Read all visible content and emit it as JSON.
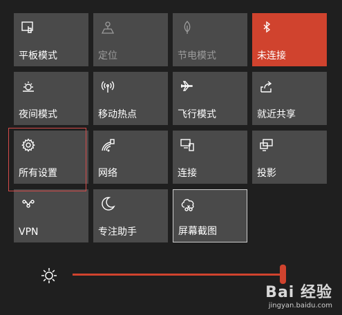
{
  "tiles": [
    {
      "label": "平板模式",
      "icon": "tablet-mode-icon",
      "state": "normal"
    },
    {
      "label": "定位",
      "icon": "location-icon",
      "state": "disabled"
    },
    {
      "label": "节电模式",
      "icon": "battery-saver-icon",
      "state": "disabled"
    },
    {
      "label": "未连接",
      "icon": "bluetooth-icon",
      "state": "active"
    },
    {
      "label": "夜间模式",
      "icon": "night-light-icon",
      "state": "normal"
    },
    {
      "label": "移动热点",
      "icon": "mobile-hotspot-icon",
      "state": "normal"
    },
    {
      "label": "飞行模式",
      "icon": "airplane-icon",
      "state": "normal"
    },
    {
      "label": "就近共享",
      "icon": "nearby-sharing-icon",
      "state": "normal"
    },
    {
      "label": "所有设置",
      "icon": "gear-icon",
      "state": "normal"
    },
    {
      "label": "网络",
      "icon": "network-icon",
      "state": "normal"
    },
    {
      "label": "连接",
      "icon": "connect-icon",
      "state": "normal"
    },
    {
      "label": "投影",
      "icon": "project-icon",
      "state": "normal"
    },
    {
      "label": "VPN",
      "icon": "vpn-icon",
      "state": "normal"
    },
    {
      "label": "专注助手",
      "icon": "moon-icon",
      "state": "normal"
    },
    {
      "label": "屏幕截图",
      "icon": "screen-snip-icon",
      "state": "focused"
    }
  ],
  "brightness": {
    "icon": "brightness-icon",
    "value": 100
  },
  "colors": {
    "accent": "#d0432e",
    "tile": "#4a4a4a",
    "highlight_box": "#d64b49"
  },
  "watermark": {
    "logo": "Bai 经验",
    "url": "jingyan.baidu.com"
  }
}
